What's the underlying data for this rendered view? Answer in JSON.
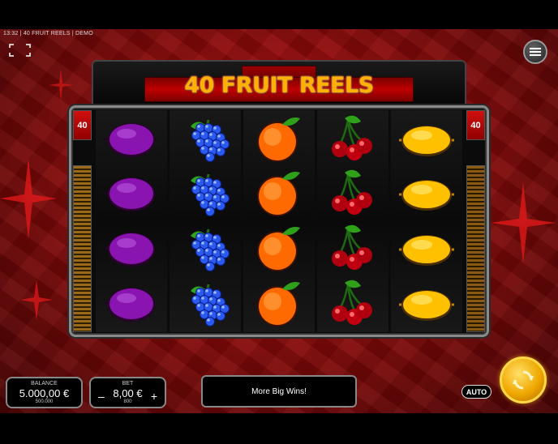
{
  "status_bar": {
    "text": "13:32 | 40 FRUIT REELS | DEMO"
  },
  "game": {
    "logo": "40 FRUIT REELS",
    "lines_left": "40",
    "lines_right": "40",
    "reels": [
      {
        "symbol": "plum-icon",
        "count": 4
      },
      {
        "symbol": "grapes-icon",
        "count": 4
      },
      {
        "symbol": "orange-icon",
        "count": 4
      },
      {
        "symbol": "cherries-icon",
        "count": 4
      },
      {
        "symbol": "lemon-icon",
        "count": 4
      }
    ]
  },
  "balance": {
    "label": "BALANCE",
    "value": "5.000,00 €",
    "credits": "500.000"
  },
  "bet": {
    "label": "BET",
    "value": "8,00 €",
    "credits": "800",
    "minus": "–",
    "plus": "+"
  },
  "message": "More Big Wins!",
  "auto_label": "AUTO",
  "colors": {
    "accent": "#ffb000",
    "background": "#b00d0d",
    "spin": "#f0a800"
  }
}
